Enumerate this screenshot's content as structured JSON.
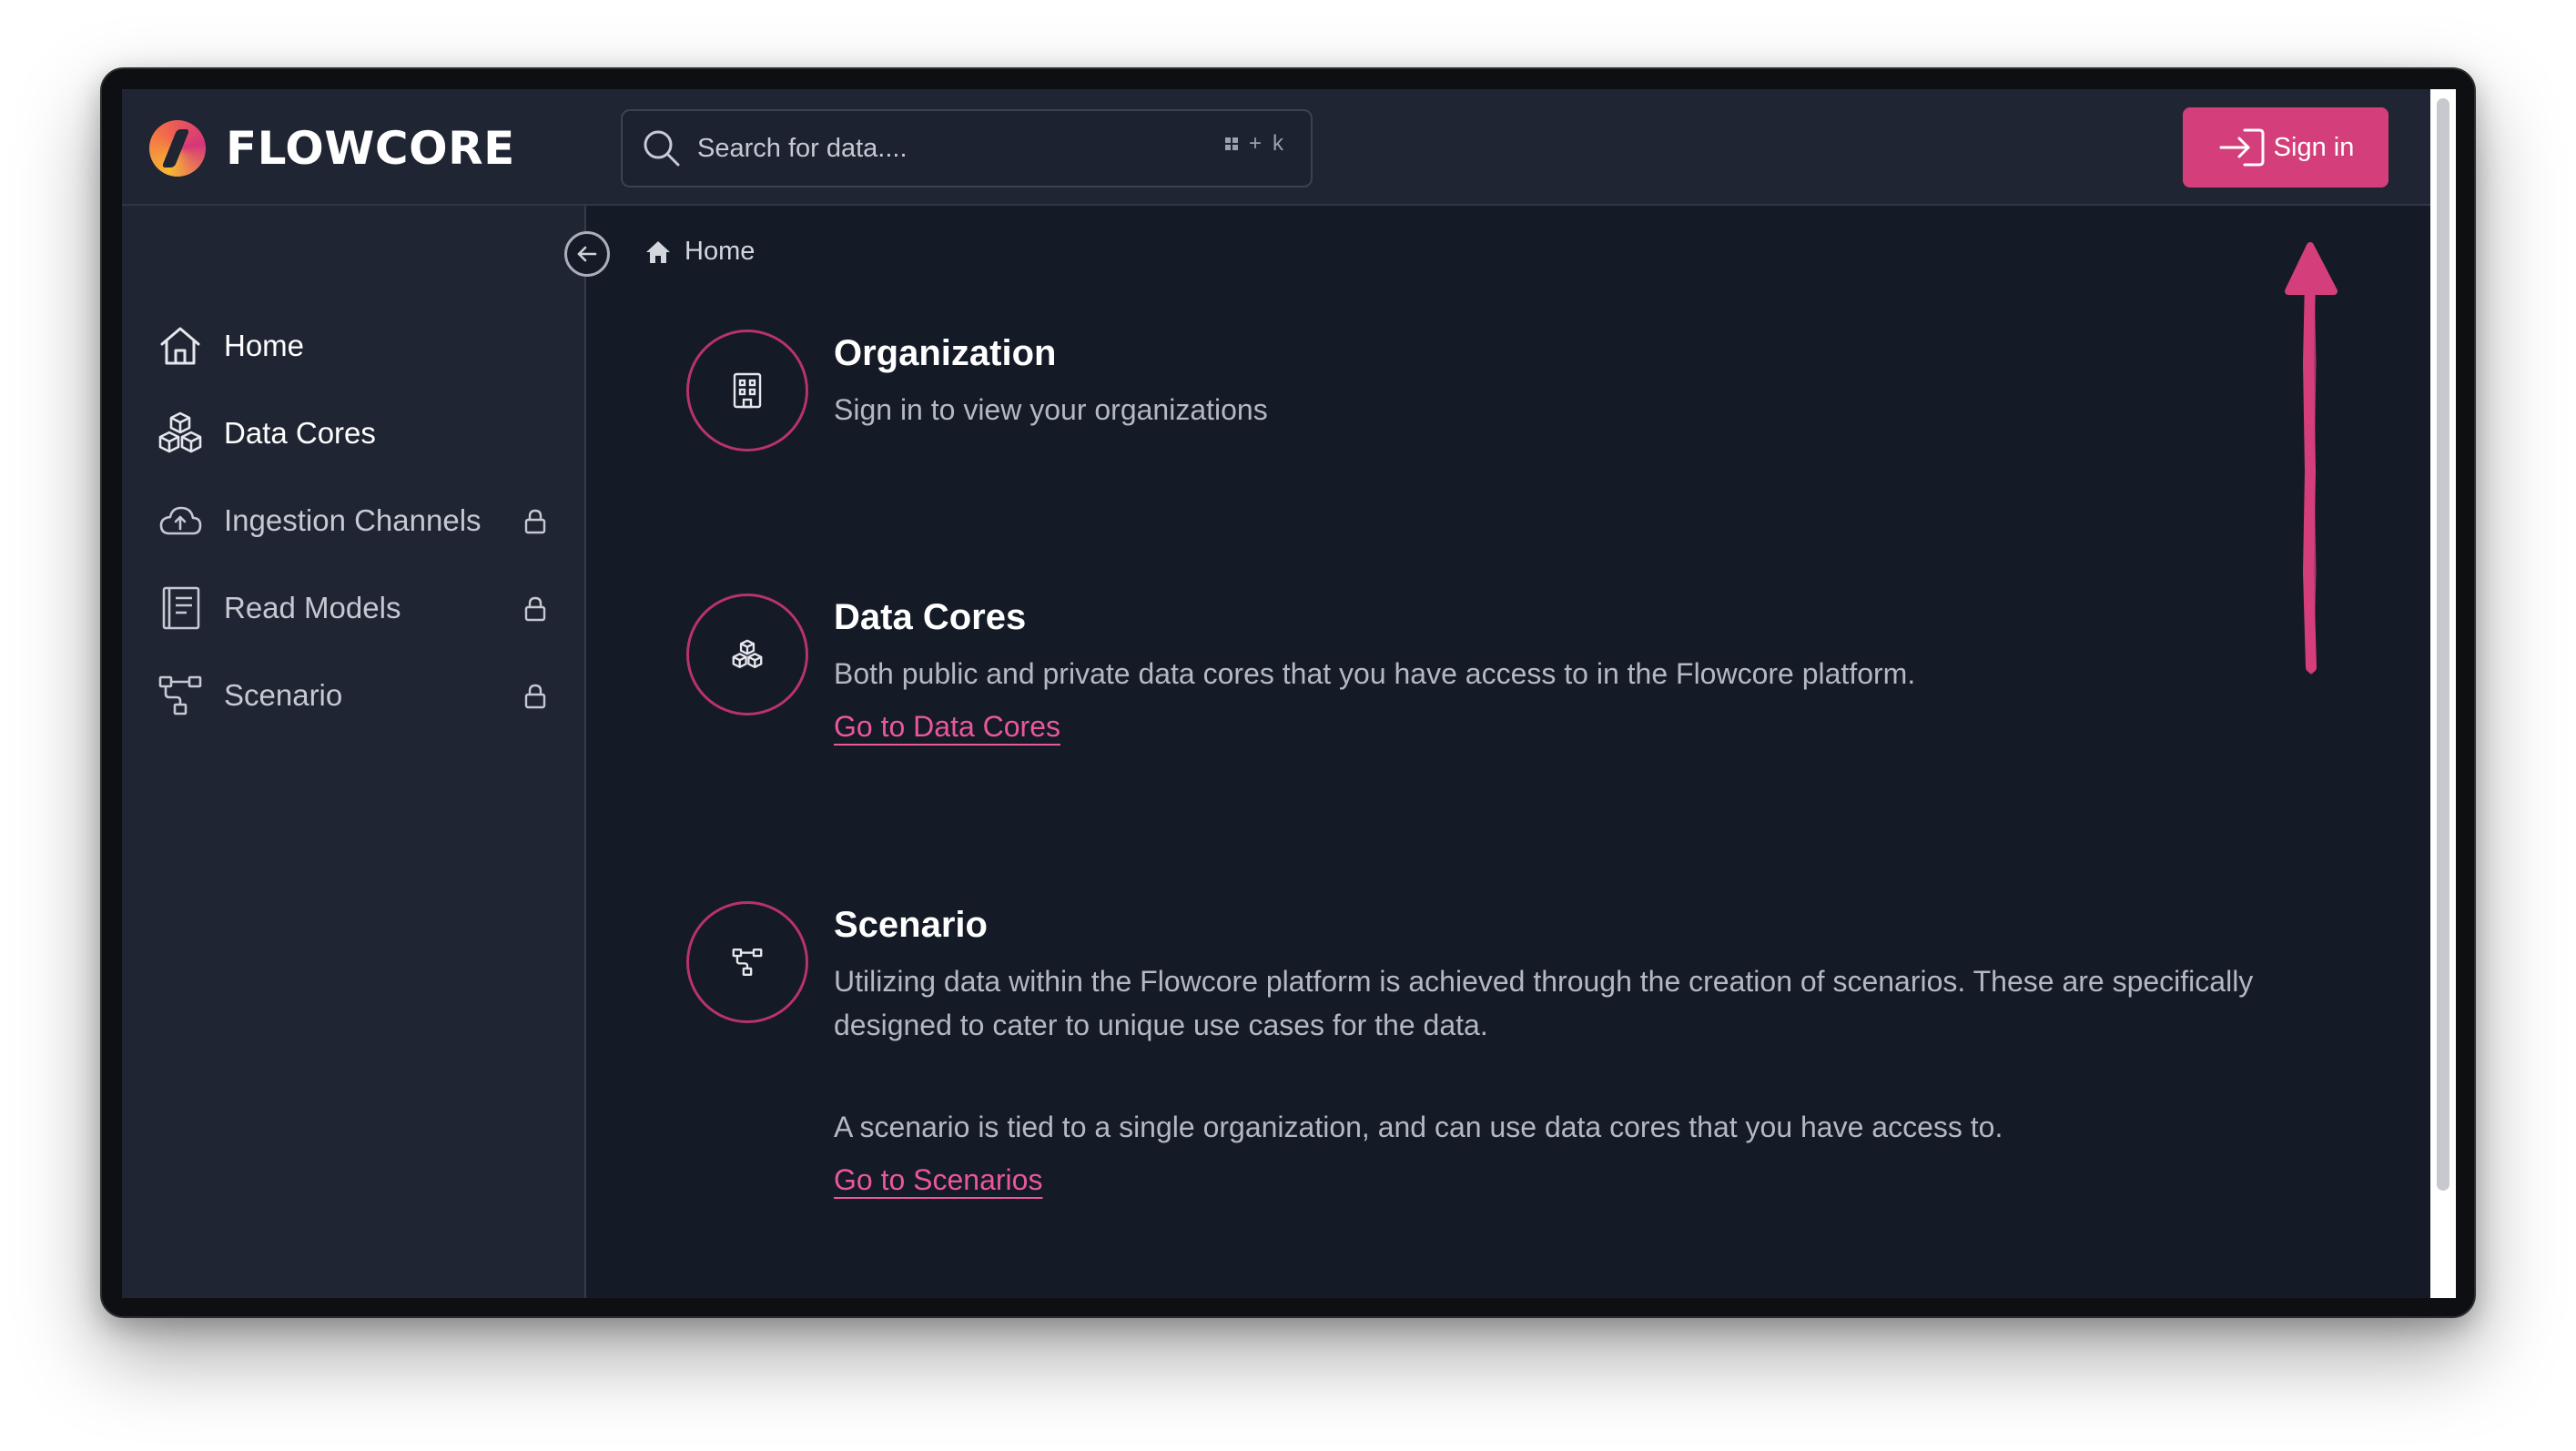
{
  "app": {
    "name": "FLOWCORE",
    "logo_icon": "flowcore-logo"
  },
  "search": {
    "placeholder": "Search for data....",
    "shortcut_plus": "+",
    "shortcut_key": "k",
    "icon": "search-icon"
  },
  "header": {
    "signin_label": "Sign in",
    "signin_icon": "sign-in-icon",
    "accent_color": "#d43f7b"
  },
  "sidebar": {
    "items": [
      {
        "label": "Home",
        "icon": "home-icon",
        "locked": false
      },
      {
        "label": "Data Cores",
        "icon": "cubes-icon",
        "locked": false
      },
      {
        "label": "Ingestion Channels",
        "icon": "cloud-upload-icon",
        "locked": true
      },
      {
        "label": "Read Models",
        "icon": "book-icon",
        "locked": true
      },
      {
        "label": "Scenario",
        "icon": "network-icon",
        "locked": true
      }
    ]
  },
  "breadcrumb": {
    "label": "Home",
    "icon": "home-solid-icon"
  },
  "sections": {
    "organization": {
      "title": "Organization",
      "text": "Sign in to view your organizations",
      "icon": "building-icon"
    },
    "data_cores": {
      "title": "Data Cores",
      "text": "Both public and private data cores that you have access to in the Flowcore platform.",
      "link": "Go to Data Cores",
      "icon": "cubes-icon"
    },
    "scenario": {
      "title": "Scenario",
      "text1": "Utilizing data within the Flowcore platform is achieved through the creation of scenarios. These are specifically designed to cater to unique use cases for the data.",
      "text2": "A scenario is tied to a single organization, and can use data cores that you have access to.",
      "link": "Go to Scenarios",
      "icon": "network-icon"
    }
  },
  "colors": {
    "background": "#141a26",
    "panel": "#1f2533",
    "link": "#e9589a",
    "circle_border": "#b8336a"
  }
}
